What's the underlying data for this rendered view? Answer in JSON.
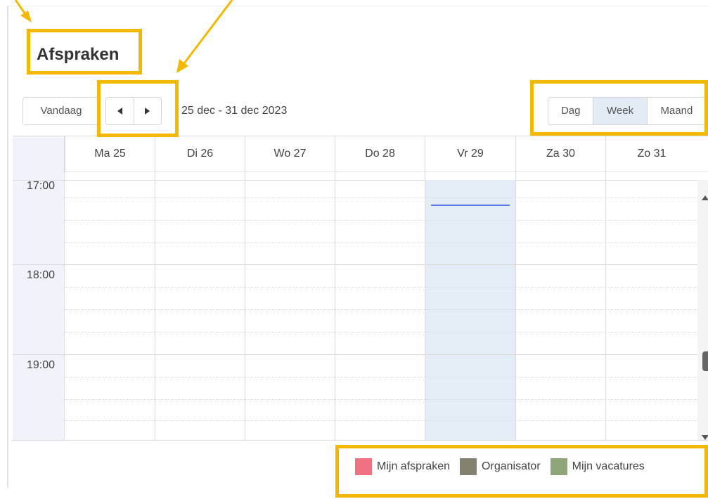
{
  "header": {
    "title": "Afspraken"
  },
  "toolbar": {
    "today_label": "Vandaag",
    "prev_icon": "caret-left-icon",
    "next_icon": "caret-right-icon",
    "date_range": "25 dec - 31 dec 2023",
    "views": [
      {
        "label": "Dag",
        "active": false
      },
      {
        "label": "Week",
        "active": true
      },
      {
        "label": "Maand",
        "active": false
      }
    ]
  },
  "calendar": {
    "days": [
      {
        "label": "Ma 25",
        "today": false
      },
      {
        "label": "Di 26",
        "today": false
      },
      {
        "label": "Wo 27",
        "today": false
      },
      {
        "label": "Do 28",
        "today": false
      },
      {
        "label": "Vr 29",
        "today": true
      },
      {
        "label": "Za 30",
        "today": false
      },
      {
        "label": "Zo 31",
        "today": false
      }
    ],
    "times": [
      "17:00",
      "18:00",
      "19:00"
    ],
    "today_highlight_color": "#e4edf6",
    "now_indicator_color": "#5b7de8"
  },
  "legend": {
    "items": [
      {
        "label": "Mijn afspraken",
        "color": "#f07182"
      },
      {
        "label": "Organisator",
        "color": "#858171"
      },
      {
        "label": "Mijn vacatures",
        "color": "#8ea67a"
      }
    ]
  },
  "annotation": {
    "highlight_color": "#f5b800"
  }
}
